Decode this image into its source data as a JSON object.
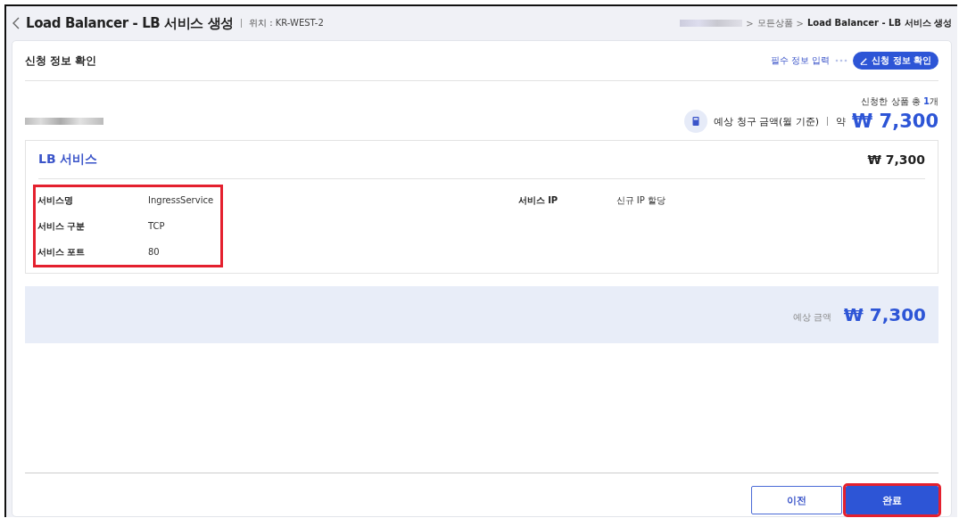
{
  "header": {
    "title": "Load Balancer - LB 서비스 생성",
    "location_label": "위치 : KR-WEST-2",
    "breadcrumb_separator": ">",
    "breadcrumb": [
      {
        "kind": "redacted"
      },
      {
        "kind": "text",
        "label": "모든상품"
      },
      {
        "kind": "current",
        "label": "Load Balancer - LB 서비스 생성"
      }
    ]
  },
  "panel": {
    "title": "신청 정보 확인",
    "steps": [
      {
        "label": "필수 정보 입력",
        "selected": false
      },
      {
        "label": "신청 정보 확인",
        "selected": true
      }
    ],
    "product_count": "신청한 상품 총 **1**개",
    "estimate_label": "예상 청구 금액(월 기준)",
    "estimate_prefix": "약",
    "estimate_amount": "₩ 7,300",
    "service": {
      "title": "LB 서비스",
      "amount": "₩ 7,300",
      "fields_left": {
        "highlighted": true,
        "rows": [
          {
            "label": "서비스명",
            "value": "IngressService"
          },
          {
            "label": "서비스 구분",
            "value": "TCP"
          },
          {
            "label": "서비스 포트",
            "value": "80"
          }
        ]
      },
      "fields_right": {
        "rows": [
          {
            "label": "서비스 IP",
            "value": "신규 IP 할당"
          }
        ]
      }
    },
    "summary": {
      "label": "예상 금액",
      "amount": "₩ 7,300"
    },
    "buttons": [
      {
        "label": "이전",
        "kind": "secondary",
        "highlighted": false
      },
      {
        "label": "완료",
        "kind": "primary",
        "highlighted": true
      }
    ]
  }
}
